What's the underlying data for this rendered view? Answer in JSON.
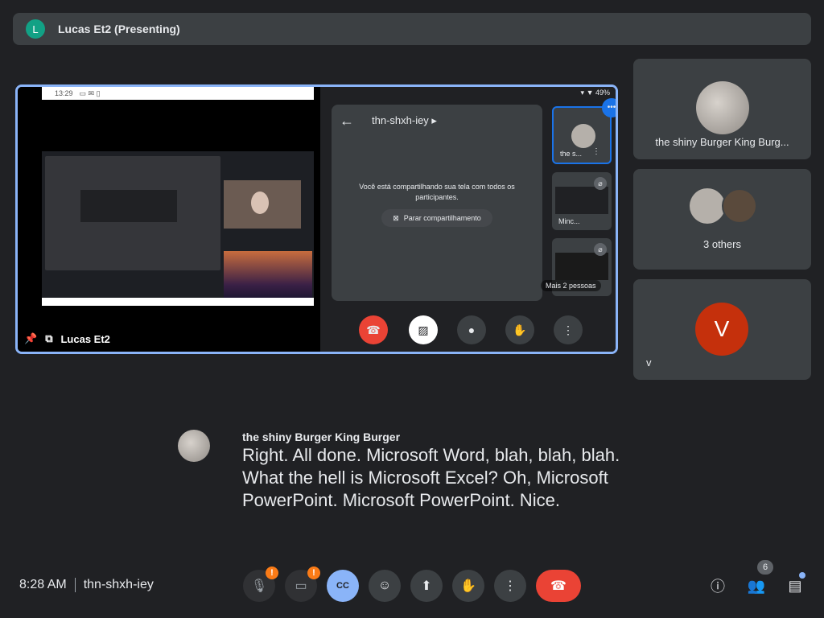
{
  "topbar": {
    "avatar_letter": "L",
    "title": "Lucas Et2 (Presenting)"
  },
  "presentation": {
    "status_time": "13:29",
    "phone_status": "49%",
    "meeting_code": "thn-shxh-iey",
    "message": "Você está compartilhando sua tela com todos os participantes.",
    "stop_label": "Parar compartilhamento",
    "mini_tiles": [
      {
        "label": "the s..."
      },
      {
        "label": "Minc..."
      }
    ],
    "more_people": "Mais 2 pessoas",
    "presenter_label": "Lucas Et2"
  },
  "side": {
    "tile1_name": "the shiny Burger King Burg...",
    "tile2_name": "3 others",
    "tile3_letter": "V",
    "tile3_name": "v"
  },
  "caption": {
    "speaker": "the shiny Burger King Burger",
    "text": "Right. All done. Microsoft Word, blah, blah, blah. What the hell is Microsoft Excel? Oh, Microsoft PowerPoint. Microsoft PowerPoint. Nice."
  },
  "footer": {
    "time": "8:28 AM",
    "meeting_code": "thn-shxh-iey",
    "cc_label": "CC",
    "warn_mark": "!",
    "participants_count": "6"
  }
}
